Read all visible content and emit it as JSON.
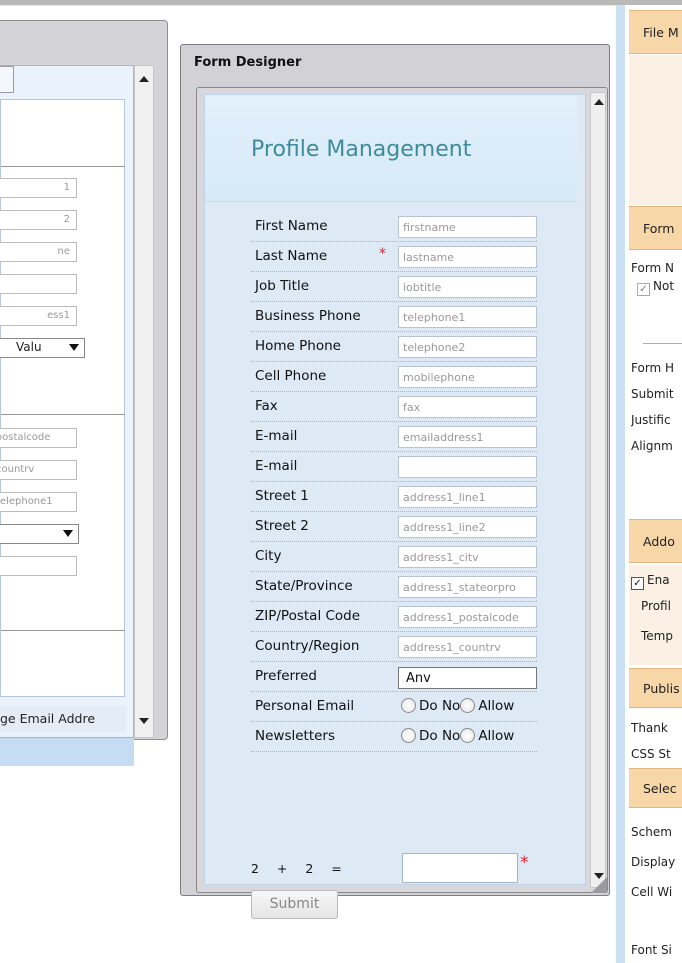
{
  "left_window": {
    "fields": [
      "1",
      "2",
      "ne",
      "",
      "ess1"
    ],
    "select_1": "Valu",
    "fields_2": [
      "oostalcode",
      "countrv",
      "telephone1"
    ],
    "select_2": "",
    "field_blank": "",
    "email_text": "ge Email Addre"
  },
  "form_designer": {
    "title": "Form Designer",
    "header_title": "Profile Management",
    "rows": [
      {
        "label": "First Name",
        "value": "firstname",
        "required": false
      },
      {
        "label": "Last Name",
        "value": "lastname",
        "required": true
      },
      {
        "label": "Job Title",
        "value": "iobtitle",
        "required": false
      },
      {
        "label": "Business Phone",
        "value": "telephone1",
        "required": false
      },
      {
        "label": "Home Phone",
        "value": "telephone2",
        "required": false
      },
      {
        "label": "Cell Phone",
        "value": "mobilephone",
        "required": false
      },
      {
        "label": "Fax",
        "value": "fax",
        "required": false
      },
      {
        "label": "E-mail",
        "value": "emailaddress1",
        "required": false
      },
      {
        "label": "E-mail",
        "value": "",
        "required": false
      },
      {
        "label": "Street 1",
        "value": "address1_line1",
        "required": false
      },
      {
        "label": "Street 2",
        "value": "address1_line2",
        "required": false
      },
      {
        "label": "City",
        "value": "address1_citv",
        "required": false
      },
      {
        "label": "State/Province",
        "value": "address1_stateorpro",
        "required": false
      },
      {
        "label": "ZIP/Postal Code",
        "value": "address1_postalcode",
        "required": false
      },
      {
        "label": "Country/Region",
        "value": "address1_countrv",
        "required": false
      }
    ],
    "required_mark": "*",
    "preferred": {
      "label": "Preferred",
      "value": "Anv"
    },
    "personal_email": {
      "label": "Personal Email",
      "option_1": "Do No",
      "option_2": "Allow"
    },
    "newsletters": {
      "label": "Newsletters",
      "option_1": "Do No",
      "option_2": "Allow"
    },
    "captcha": {
      "text": "2 + 2 =",
      "value": ""
    },
    "submit_label": "Submit"
  },
  "right_panel": {
    "file_header": "File M",
    "form_header": "Form",
    "form_name": "Form N",
    "notify_label": "Not",
    "form_h": "Form H",
    "submit": "Submit",
    "justify": "Justific",
    "alignment": "Alignm",
    "addon_header": "Addo",
    "enable_label": "Ena",
    "profile": "Profil",
    "template": "Temp",
    "publish_header": "Publis",
    "thank": "Thank",
    "css": "CSS St",
    "select_header": "Selec",
    "schema": "Schem",
    "display": "Display",
    "cell_width": "Cell Wi",
    "font_size": "Font Si"
  },
  "colors": {
    "accent_orange": "#f7d6a8",
    "title_teal": "#3d8c9c",
    "required_red": "#e0202a"
  }
}
